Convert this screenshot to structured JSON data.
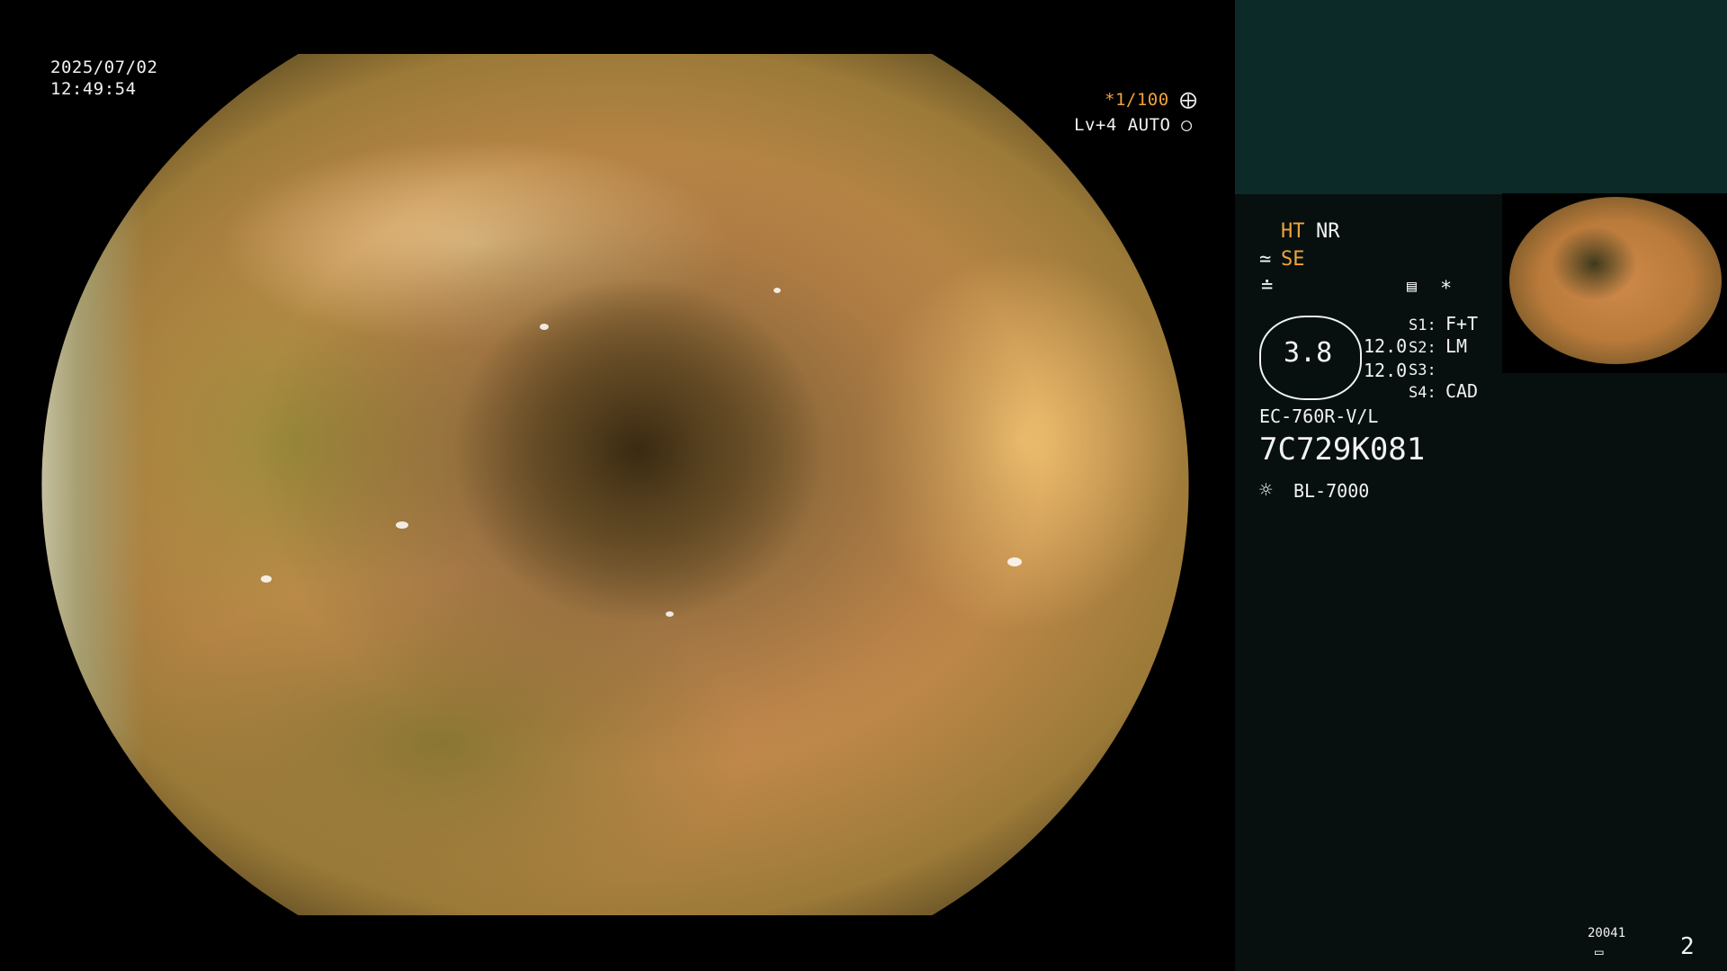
{
  "overlay": {
    "date": "2025/07/02",
    "time": "12:49:54",
    "shutter": "*1/100",
    "level": "Lv+4 AUTO"
  },
  "sidebar": {
    "ht": "HT",
    "nr": "NR",
    "se": "SE",
    "zoom_value": "3.8",
    "val1": "12.0",
    "val2": "12.0",
    "s1": "S1:",
    "s1_val": "F+T",
    "s2": "S2:",
    "s2_val": "LM",
    "s3": "S3:",
    "s3_val": "",
    "s4": "S4:",
    "s4_val": "CAD",
    "scope_model": "EC-760R-V/L",
    "serial": "7C729K081",
    "light_source": "BL-7000",
    "record_count": "20041",
    "page_number": "2",
    "asterisk": "*"
  },
  "colors": {
    "accent": "#f0a23c",
    "panel_top": "#0b2a28",
    "panel": "#07100f"
  },
  "icons": {
    "shutter_icon": "aperture-icon",
    "auto_icon": "auto-exposure-icon",
    "se_icon": "scope-tip-icon",
    "filter_icon": "filter-icon",
    "settings_icon": "settings-panel-icon",
    "light_icon": "lamp-icon",
    "disk_icon": "disk-icon"
  }
}
